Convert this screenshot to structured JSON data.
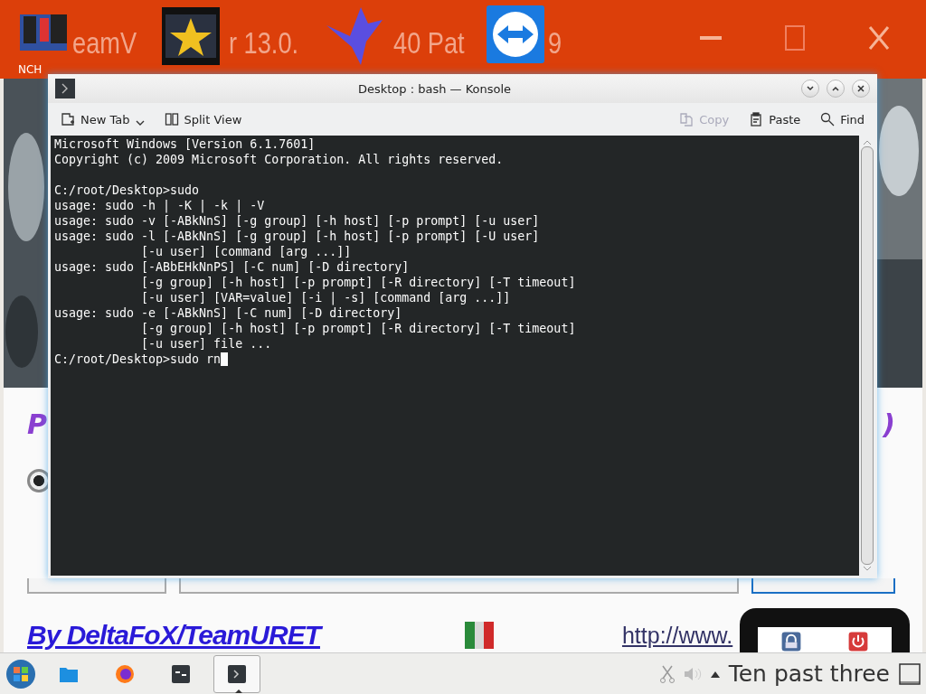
{
  "background_window": {
    "title_fragments": [
      "eamV",
      "r 13.0.",
      "40 Pat",
      "9"
    ],
    "desktop_icon_label": "NCH",
    "heading_left": "P",
    "heading_right": ")",
    "radio": {
      "selected": true
    },
    "author_link": "By DeltaFoX/TeamURET",
    "url_link": "http://www."
  },
  "konsole": {
    "title": "Desktop : bash — Konsole",
    "toolbar": [
      {
        "kind": "newtab",
        "label": "New Tab",
        "disabled": false
      },
      {
        "kind": "split",
        "label": "Split View",
        "disabled": false
      },
      {
        "kind": "copy",
        "label": "Copy",
        "disabled": true
      },
      {
        "kind": "paste",
        "label": "Paste",
        "disabled": false
      },
      {
        "kind": "find",
        "label": "Find",
        "disabled": false
      }
    ],
    "terminal_blocks": [
      [
        "Microsoft Windows [Version 6.1.7601]",
        "Copyright (c) 2009 Microsoft Corporation. All rights reserved."
      ],
      [
        "C:/root/Desktop>sudo",
        "usage: sudo -h | -K | -k | -V",
        "usage: sudo -v [-ABkNnS] [-g group] [-h host] [-p prompt] [-u user]",
        "usage: sudo -l [-ABkNnS] [-g group] [-h host] [-p prompt] [-U user]",
        "            [-u user] [command [arg ...]]",
        "usage: sudo [-ABbEHkNnPS] [-C num] [-D directory]",
        "            [-g group] [-h host] [-p prompt] [-R directory] [-T timeout]",
        "            [-u user] [VAR=value] [-i | -s] [command [arg ...]]",
        "usage: sudo -e [-ABkNnS] [-C num] [-D directory]",
        "            [-g group] [-h host] [-p prompt] [-R directory] [-T timeout]",
        "            [-u user] file ...",
        "C:/root/Desktop>sudo rn"
      ]
    ],
    "cursor_visible": true
  },
  "taskbar": {
    "apps": [
      {
        "kind": "files",
        "selected": false
      },
      {
        "kind": "firefox",
        "selected": false
      },
      {
        "kind": "app",
        "selected": false
      },
      {
        "kind": "konsole",
        "selected": true
      }
    ],
    "clock": "Ten past three"
  }
}
